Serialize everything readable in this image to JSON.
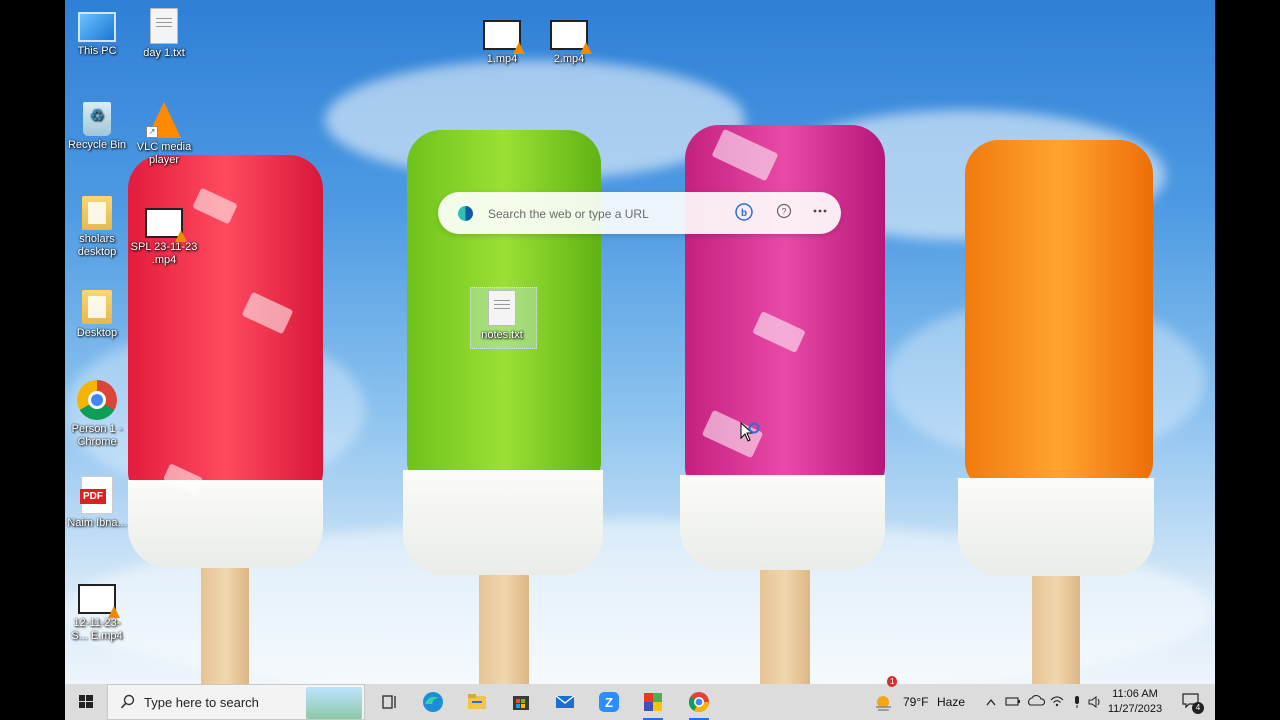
{
  "desktop": {
    "icons": [
      {
        "label": "This PC",
        "icon": "this-pc-icon"
      },
      {
        "label": "day 1.txt",
        "icon": "text-file-icon"
      },
      {
        "label": "1.mp4",
        "icon": "video-file-icon"
      },
      {
        "label": "2.mp4",
        "icon": "video-file-icon"
      },
      {
        "label": "Recycle Bin",
        "icon": "recycle-bin-icon"
      },
      {
        "label": "VLC media player",
        "icon": "vlc-icon"
      },
      {
        "label": "sholars desktop",
        "icon": "folder-icon"
      },
      {
        "label": "SPL 23-11-23 .mp4",
        "icon": "video-file-icon"
      },
      {
        "label": "Desktop",
        "icon": "folder-icon"
      },
      {
        "label": "notes.txt",
        "icon": "text-file-icon"
      },
      {
        "label": "Person 1 - Chrome",
        "icon": "chrome-icon"
      },
      {
        "label": "Naim Ibna...",
        "icon": "pdf-icon"
      },
      {
        "label": "12-11-23-S... E.mp4",
        "icon": "video-file-icon"
      }
    ]
  },
  "edge_search": {
    "placeholder": "Search the web or type a URL"
  },
  "taskbar": {
    "search_placeholder": "Type here to search",
    "apps": [
      "task-view-icon",
      "edge-icon",
      "file-explorer-icon",
      "store-icon",
      "mail-icon",
      "zoom-icon",
      "app-icon",
      "chrome-icon"
    ],
    "weather": {
      "alert_count": "1",
      "temp": "79°F",
      "condition": "Haze"
    },
    "clock": {
      "time": "11:06 AM",
      "date": "11/27/2023"
    },
    "notifications": "4"
  },
  "colors": {
    "taskbar": "#dcdcdc",
    "accent": "#1a73e8"
  }
}
